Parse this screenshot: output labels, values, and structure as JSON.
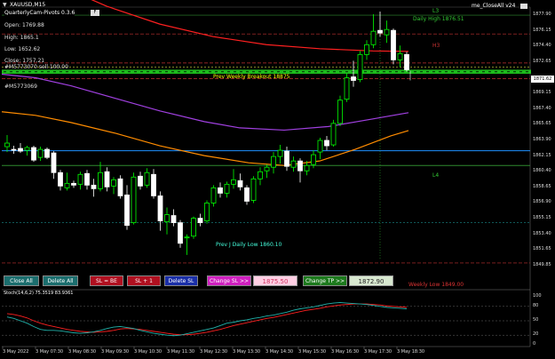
{
  "header": {
    "symbol_title": "XAUUSD,M15",
    "indicator_name": "QuarterlyCam-Pivots 0.3.6",
    "indicator_marker": "F",
    "top_right_label": "me_CloseAll v24",
    "settings_marker": "▼"
  },
  "ohlc": {
    "open": "Open: 1769.88",
    "high": "High: 1865.1",
    "low": "Low: 1652.62",
    "close": "Close: 1757.21",
    "ticket_1": "#M5773070 sell 100.00",
    "ticket_2": "#M5773069"
  },
  "levels": {
    "l3": "L3",
    "h3": "H3",
    "l4": "L4",
    "daily_high": "Daily High 1876.51",
    "prev_weekly_high": "Prev Weekly Breakout 18875",
    "prev_daily_low": "Prev J Daily Low 1860.10",
    "weekly_low": "Weekly Low 1849.00"
  },
  "price_axis": [
    "1877.90",
    "1876.15",
    "1874.40",
    "1872.65",
    "1871.62",
    "1869.15",
    "1867.40",
    "1865.65",
    "1863.90",
    "1862.15",
    "1860.40",
    "1858.65",
    "1856.90",
    "1855.15",
    "1853.40",
    "1851.65",
    "1849.85"
  ],
  "price_tags": {
    "current": "1871.62"
  },
  "buttons": {
    "close_all": "Close All",
    "delete_all": "Delete All",
    "sl_be": "SL = BE",
    "sl_plus": "SL + 1",
    "delete_sl": "Delete SL",
    "change_sl": "Change SL >>",
    "sl_value": "1875.50",
    "change_tp": "Change TP >>",
    "tp_value": "1872.90"
  },
  "oscillator": {
    "title": "Stoch(14,6,2) 75.3519 83.9361",
    "axis": [
      "100",
      "80",
      "50",
      "20",
      "0"
    ]
  },
  "time_axis": [
    "3 May 2022",
    "3 May 07:30",
    "3 May 08:30",
    "3 May 09:30",
    "3 May 10:30",
    "3 May 11:30",
    "3 May 12:30",
    "3 May 13:30",
    "3 May 14:30",
    "3 May 15:30",
    "3 May 16:30",
    "3 May 17:30",
    "3 May 18:30"
  ],
  "colors": {
    "background": "#000000",
    "bull_candle": "#00ff00",
    "bear_candle": "#ffffff",
    "ma_red": "#ff2020",
    "ma_purple": "#a040e0",
    "ma_orange": "#ff8c00",
    "line_blue": "#1e90ff",
    "line_green": "#2e8b2e",
    "level_red_dash": "#c03030",
    "stoch_main": "#20b2aa",
    "stoch_signal": "#ff2020"
  },
  "candles": [
    {
      "o": 1863.2,
      "h": 1864.5,
      "l": 1862.6,
      "c": 1863.6
    },
    {
      "o": 1862.9,
      "h": 1863.3,
      "l": 1862.4,
      "c": 1862.8
    },
    {
      "o": 1863.0,
      "h": 1863.6,
      "l": 1862.5,
      "c": 1862.7
    },
    {
      "o": 1862.8,
      "h": 1863.3,
      "l": 1862.2,
      "c": 1863.1
    },
    {
      "o": 1863.1,
      "h": 1863.3,
      "l": 1861.5,
      "c": 1861.7
    },
    {
      "o": 1862.0,
      "h": 1863.2,
      "l": 1861.6,
      "c": 1862.9
    },
    {
      "o": 1862.9,
      "h": 1863.1,
      "l": 1861.8,
      "c": 1862.0
    },
    {
      "o": 1862.5,
      "h": 1862.7,
      "l": 1859.6,
      "c": 1860.3
    },
    {
      "o": 1860.3,
      "h": 1860.6,
      "l": 1858.3,
      "c": 1858.8
    },
    {
      "o": 1858.6,
      "h": 1860.3,
      "l": 1858.3,
      "c": 1859.1
    },
    {
      "o": 1859.1,
      "h": 1859.4,
      "l": 1858.6,
      "c": 1858.9
    },
    {
      "o": 1859.0,
      "h": 1860.4,
      "l": 1858.4,
      "c": 1860.1
    },
    {
      "o": 1860.2,
      "h": 1860.6,
      "l": 1858.4,
      "c": 1858.9
    },
    {
      "o": 1858.9,
      "h": 1859.6,
      "l": 1857.6,
      "c": 1858.5
    },
    {
      "o": 1858.5,
      "h": 1861.5,
      "l": 1858.2,
      "c": 1860.3
    },
    {
      "o": 1860.4,
      "h": 1860.9,
      "l": 1858.2,
      "c": 1858.7
    },
    {
      "o": 1858.8,
      "h": 1859.8,
      "l": 1857.9,
      "c": 1859.5
    },
    {
      "o": 1859.6,
      "h": 1860.0,
      "l": 1857.4,
      "c": 1857.7
    },
    {
      "o": 1857.8,
      "h": 1858.9,
      "l": 1853.9,
      "c": 1854.4
    },
    {
      "o": 1854.7,
      "h": 1860.3,
      "l": 1854.5,
      "c": 1859.8
    },
    {
      "o": 1859.9,
      "h": 1860.4,
      "l": 1858.4,
      "c": 1858.8
    },
    {
      "o": 1858.9,
      "h": 1860.8,
      "l": 1858.6,
      "c": 1860.3
    },
    {
      "o": 1860.1,
      "h": 1860.7,
      "l": 1857.4,
      "c": 1857.7
    },
    {
      "o": 1857.7,
      "h": 1858.2,
      "l": 1853.8,
      "c": 1854.9
    },
    {
      "o": 1854.8,
      "h": 1856.4,
      "l": 1853.4,
      "c": 1855.6
    },
    {
      "o": 1855.5,
      "h": 1856.2,
      "l": 1854.3,
      "c": 1854.7
    },
    {
      "o": 1854.7,
      "h": 1855.0,
      "l": 1851.9,
      "c": 1852.4
    },
    {
      "o": 1853.0,
      "h": 1853.4,
      "l": 1851.1,
      "c": 1853.1
    },
    {
      "o": 1853.2,
      "h": 1855.4,
      "l": 1852.9,
      "c": 1855.2
    },
    {
      "o": 1855.2,
      "h": 1855.7,
      "l": 1854.3,
      "c": 1854.7
    },
    {
      "o": 1854.9,
      "h": 1857.2,
      "l": 1854.6,
      "c": 1856.9
    },
    {
      "o": 1856.9,
      "h": 1858.9,
      "l": 1856.5,
      "c": 1858.6
    },
    {
      "o": 1858.6,
      "h": 1859.2,
      "l": 1857.5,
      "c": 1858.0
    },
    {
      "o": 1858.0,
      "h": 1859.3,
      "l": 1857.5,
      "c": 1859.0
    },
    {
      "o": 1859.0,
      "h": 1860.7,
      "l": 1858.5,
      "c": 1859.5
    },
    {
      "o": 1859.4,
      "h": 1860.2,
      "l": 1858.3,
      "c": 1858.7
    },
    {
      "o": 1858.6,
      "h": 1858.9,
      "l": 1856.7,
      "c": 1857.1
    },
    {
      "o": 1857.2,
      "h": 1859.9,
      "l": 1856.9,
      "c": 1859.6
    },
    {
      "o": 1859.6,
      "h": 1860.9,
      "l": 1858.9,
      "c": 1860.4
    },
    {
      "o": 1860.5,
      "h": 1861.2,
      "l": 1859.7,
      "c": 1860.9
    },
    {
      "o": 1860.9,
      "h": 1862.6,
      "l": 1860.2,
      "c": 1862.1
    },
    {
      "o": 1862.1,
      "h": 1863.4,
      "l": 1861.3,
      "c": 1862.8
    },
    {
      "o": 1862.7,
      "h": 1863.2,
      "l": 1860.5,
      "c": 1861.0
    },
    {
      "o": 1860.9,
      "h": 1862.1,
      "l": 1860.4,
      "c": 1861.6
    },
    {
      "o": 1861.6,
      "h": 1861.9,
      "l": 1859.2,
      "c": 1860.5
    },
    {
      "o": 1860.5,
      "h": 1861.6,
      "l": 1860.0,
      "c": 1861.1
    },
    {
      "o": 1861.2,
      "h": 1862.8,
      "l": 1860.8,
      "c": 1862.3
    },
    {
      "o": 1862.6,
      "h": 1864.2,
      "l": 1861.8,
      "c": 1863.9
    },
    {
      "o": 1863.9,
      "h": 1864.4,
      "l": 1862.8,
      "c": 1863.3
    },
    {
      "o": 1863.4,
      "h": 1866.2,
      "l": 1863.2,
      "c": 1865.8
    },
    {
      "o": 1865.8,
      "h": 1868.9,
      "l": 1865.5,
      "c": 1868.4
    },
    {
      "o": 1868.5,
      "h": 1871.4,
      "l": 1868.2,
      "c": 1870.9
    },
    {
      "o": 1871.0,
      "h": 1872.8,
      "l": 1869.9,
      "c": 1870.6
    },
    {
      "o": 1870.7,
      "h": 1873.9,
      "l": 1870.4,
      "c": 1873.5
    },
    {
      "o": 1873.5,
      "h": 1875.1,
      "l": 1872.9,
      "c": 1874.6
    },
    {
      "o": 1874.6,
      "h": 1878.0,
      "l": 1874.2,
      "c": 1876.1
    },
    {
      "o": 1876.2,
      "h": 1878.3,
      "l": 1875.5,
      "c": 1875.9
    },
    {
      "o": 1875.7,
      "h": 1877.3,
      "l": 1874.8,
      "c": 1876.3
    },
    {
      "o": 1876.2,
      "h": 1876.4,
      "l": 1872.4,
      "c": 1872.9
    },
    {
      "o": 1872.9,
      "h": 1874.5,
      "l": 1872.1,
      "c": 1873.6
    },
    {
      "o": 1873.5,
      "h": 1873.8,
      "l": 1871.6,
      "c": 1871.8
    }
  ],
  "stoch_main": [
    58,
    55,
    50,
    45,
    38,
    32,
    30,
    30,
    29,
    27,
    25,
    24,
    25,
    27,
    30,
    34,
    37,
    38,
    36,
    34,
    30,
    27,
    24,
    22,
    20,
    19,
    20,
    23,
    26,
    29,
    32,
    35,
    40,
    45,
    47,
    50,
    52,
    55,
    57,
    60,
    62,
    65,
    68,
    72,
    75,
    77,
    79,
    82,
    85,
    87,
    88,
    87,
    86,
    85,
    84,
    82,
    80,
    78,
    77,
    76,
    75
  ],
  "stoch_signal": [
    65,
    63,
    60,
    56,
    50,
    45,
    41,
    38,
    35,
    32,
    30,
    28,
    27,
    26,
    27,
    28,
    30,
    33,
    34,
    33,
    32,
    30,
    28,
    26,
    24,
    22,
    21,
    21,
    22,
    24,
    26,
    29,
    32,
    36,
    40,
    43,
    46,
    49,
    52,
    55,
    57,
    60,
    63,
    66,
    69,
    72,
    74,
    76,
    79,
    81,
    83,
    84,
    85,
    85,
    85,
    84,
    83,
    81,
    80,
    79,
    78
  ]
}
